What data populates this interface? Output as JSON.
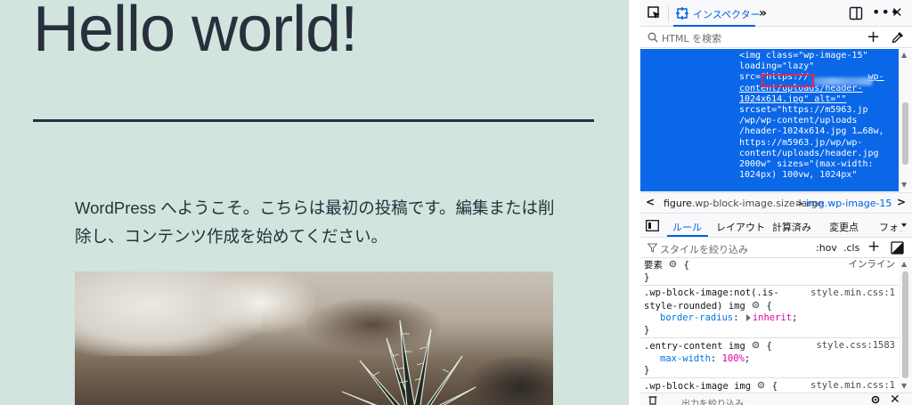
{
  "page": {
    "title": "Hello world!",
    "paragraph": "WordPress へようこそ。こちらは最初の投稿です。編集または削除し、コンテンツ作成を始めてください。"
  },
  "devtools": {
    "inspector_tab": "インスペクター",
    "more_tabs": "»",
    "menu": "•••",
    "close": "✕",
    "search_placeholder": "HTML を検索",
    "add": "+",
    "markup_lines": [
      "<img class=\"wp-image-15\"",
      "loading=\"lazy\"",
      "src=\"https://",
      "content/uploads/header-",
      "1024x614.jpg\" alt=\"\"",
      "srcset=\"https://m5963.jp",
      "/wp/wp-content/uploads",
      "/header-1024x614.jpg 1…68w,",
      "https://m5963.jp/wp/wp-",
      "content/uploads/header.jpg",
      "2000w\" sizes=\"(max-width:",
      "1024px) 100vw, 1024px\""
    ],
    "markup_src_tail": "wp-",
    "breadcrumb": {
      "left_arrow": "<",
      "item1_tag": "figure",
      "item1_class": ".wp-block-image.size-large",
      "sep": ">",
      "item2": "img.wp-image-15",
      "right_arrow": ">"
    },
    "rule_tabs": [
      "ルール",
      "レイアウト",
      "計算済み",
      "変更点",
      "フォン"
    ],
    "filter": {
      "placeholder": "スタイルを絞り込み",
      "hov": ":hov",
      ".cls": ".cls",
      "add": "+"
    },
    "rules": [
      {
        "selector": "要素",
        "brace": "{",
        "source": "インライン",
        "props": [],
        "close": "}"
      },
      {
        "selector": ".wp-block-image:not(.is-",
        "selector2": "style-rounded) img",
        "brace": "{",
        "source": "style.min.css:1",
        "props": [
          {
            "name": "border-radius",
            "value": "inherit"
          }
        ],
        "close": "}"
      },
      {
        "selector": ".entry-content img",
        "brace": "{",
        "source": "style.css:1583",
        "props": [
          {
            "name": "max-width",
            "value": "100%"
          }
        ],
        "close": "}"
      },
      {
        "selector": ".wp-block-image img",
        "brace": "{",
        "source": "style.min.css:1",
        "props": [],
        "close": ""
      }
    ],
    "bottom_text": "出力を絞り込み"
  },
  "colors": {
    "page_bg": "#d1e4dd",
    "text_dark": "#28303d",
    "selection_blue": "#0a67e8",
    "accent_blue": "#0061e0",
    "highlight_red": "#e22850",
    "prop_name": "#0074e8",
    "prop_value": "#dd00a9"
  },
  "icons": [
    "element-picker-icon",
    "inspector-icon",
    "dock-icon",
    "search-icon",
    "eyedropper-icon",
    "sidebar-toggle-icon",
    "filter-icon",
    "color-palette-icon",
    "gear-icon",
    "trash-icon"
  ]
}
